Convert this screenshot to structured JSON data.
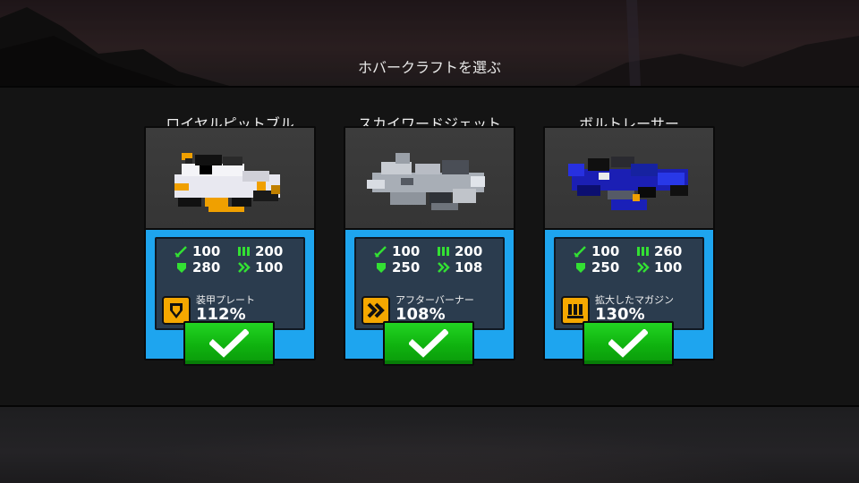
{
  "header": {
    "title": "ホバークラフトを選ぶ"
  },
  "colors": {
    "card_blue": "#1ea5ef",
    "stat_green": "#33e033",
    "perk_orange": "#f5a800",
    "button_green": "#14c414"
  },
  "cards": [
    {
      "name": "ロイヤルピットブル",
      "stats": {
        "attack": "100",
        "ammo": "200",
        "armor": "280",
        "speed": "100"
      },
      "perk": {
        "icon": "shield-icon",
        "label": "装甲プレート",
        "value": "112%"
      },
      "select_icon": "checkmark-icon"
    },
    {
      "name": "スカイワードジェット",
      "stats": {
        "attack": "100",
        "ammo": "200",
        "armor": "250",
        "speed": "108"
      },
      "perk": {
        "icon": "afterburner-icon",
        "label": "アフターバーナー",
        "value": "108%"
      },
      "select_icon": "checkmark-icon"
    },
    {
      "name": "ボルトレーサー",
      "stats": {
        "attack": "100",
        "ammo": "260",
        "armor": "250",
        "speed": "100"
      },
      "perk": {
        "icon": "magazine-icon",
        "label": "拡大したマガジン",
        "value": "130%"
      },
      "select_icon": "checkmark-icon"
    }
  ]
}
